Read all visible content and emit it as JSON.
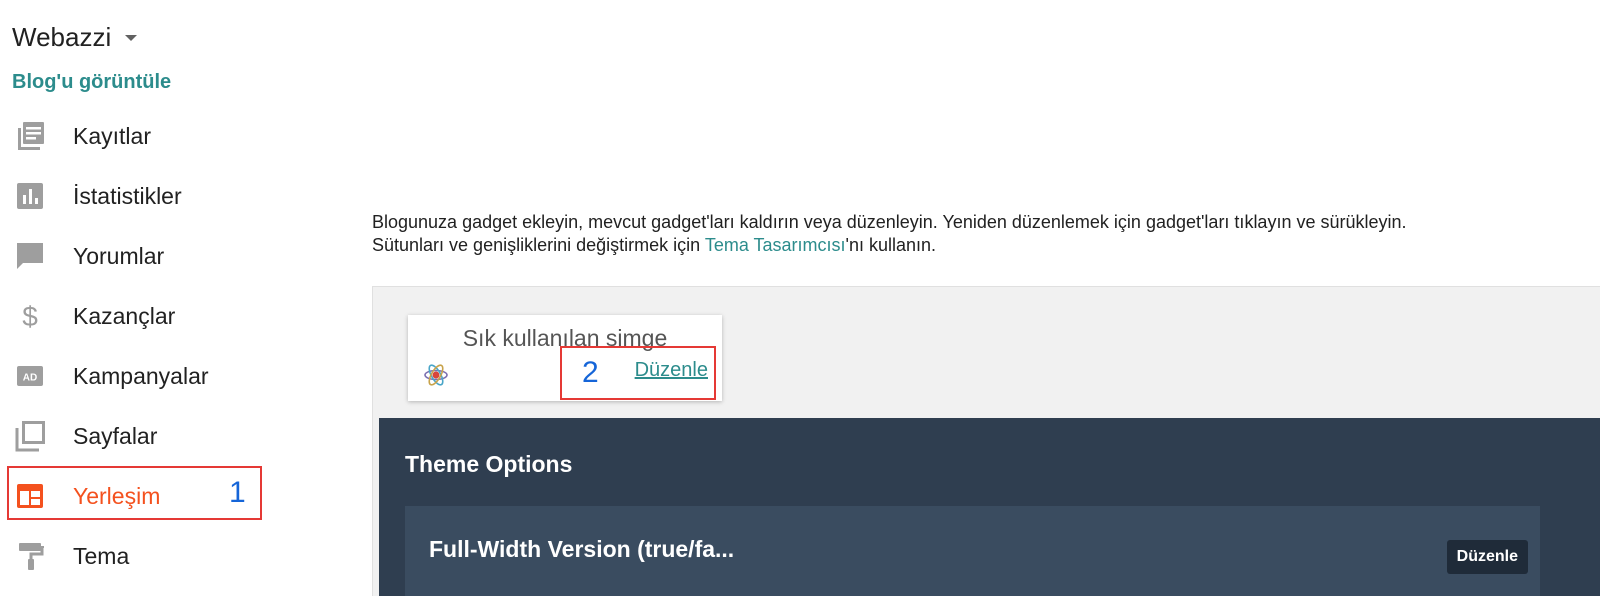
{
  "sidebar": {
    "blog_name": "Webazzi",
    "view_blog": "Blog'u görüntüle",
    "items": [
      {
        "label": "Kayıtlar",
        "icon": "posts-icon"
      },
      {
        "label": "İstatistikler",
        "icon": "stats-icon"
      },
      {
        "label": "Yorumlar",
        "icon": "comments-icon"
      },
      {
        "label": "Kazançlar",
        "icon": "dollar-icon"
      },
      {
        "label": "Kampanyalar",
        "icon": "ad-icon"
      },
      {
        "label": "Sayfalar",
        "icon": "pages-icon"
      },
      {
        "label": "Yerleşim",
        "icon": "layout-icon",
        "active": true
      },
      {
        "label": "Tema",
        "icon": "theme-roller-icon"
      }
    ]
  },
  "annotations": {
    "marker_1": "1",
    "marker_2": "2"
  },
  "main": {
    "description_line1": "Blogunuza gadget ekleyin, mevcut gadget'ları kaldırın veya düzenleyin. Yeniden düzenlemek için gadget'ları tıklayın ve sürükleyin.",
    "description_line2_prefix": "Sütunları ve genişliklerini değiştirmek için ",
    "description_link": "Tema Tasarımcısı",
    "description_line2_suffix": "'nı kullanın.",
    "gadget": {
      "title": "Sık kullanılan simge",
      "edit_label": "Düzenle",
      "icon": "atom-favicon-icon"
    },
    "theme_options": {
      "title": "Theme Options",
      "row_label": "Full-Width Version (true/fa...",
      "row_edit_label": "Düzenle"
    }
  },
  "colors": {
    "accent": "#2c8c8c",
    "active": "#f4511e",
    "annotation_border": "#e53935",
    "annotation_number": "#1565d8",
    "theme_panel": "#2f3e50",
    "theme_row": "#3a4c60"
  }
}
